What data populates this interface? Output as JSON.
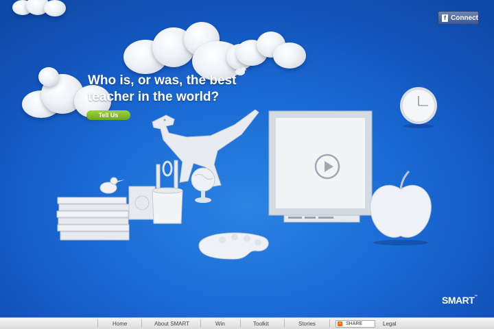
{
  "social": {
    "connect_label": "Connect",
    "icon": "facebook-icon",
    "color": "#3b5998"
  },
  "hero": {
    "headline": "Who is, or was, the best teacher in the world?",
    "cta_label": "Tell Us",
    "cta_color": "#8cc63f"
  },
  "scene": {
    "play_icon": "play-icon",
    "background_color": "#1a6ad4"
  },
  "brand": {
    "logo_text": "SMART",
    "trademark": "™"
  },
  "footer": {
    "links": [
      "Home",
      "About SMART",
      "Win",
      "Toolkit",
      "Stories"
    ],
    "share_label": "SHARE",
    "legal_label": "Legal"
  }
}
